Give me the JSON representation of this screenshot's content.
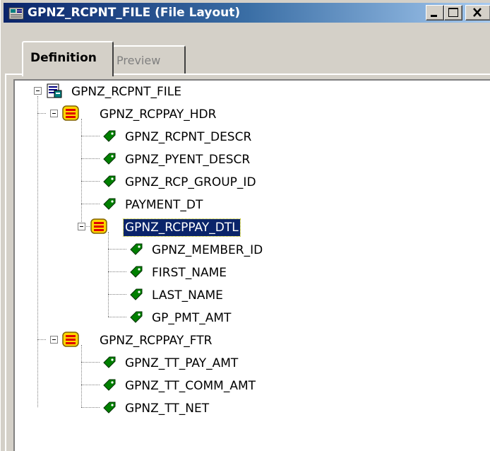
{
  "window": {
    "title": "GPNZ_RCPNT_FILE (File Layout)",
    "icon": "file-layout-icon"
  },
  "tabs": [
    {
      "label": "Definition",
      "active": true
    },
    {
      "label": "Preview",
      "active": false
    }
  ],
  "tree": {
    "root": {
      "label": "GPNZ_RCPNT_FILE",
      "icon": "file-layout-icon",
      "expanded": true
    },
    "records": [
      {
        "label": "GPNZ_RCPPAY_HDR",
        "icon": "record-icon",
        "expanded": true,
        "fields": [
          {
            "label": "GPNZ_RCPNT_DESCR",
            "icon": "field-icon"
          },
          {
            "label": "GPNZ_PYENT_DESCR",
            "icon": "field-icon"
          },
          {
            "label": "GPNZ_RCP_GROUP_ID",
            "icon": "field-icon"
          },
          {
            "label": "PAYMENT_DT",
            "icon": "field-icon"
          }
        ],
        "child_record": {
          "label": "GPNZ_RCPPAY_DTL",
          "icon": "record-icon",
          "expanded": true,
          "selected": true,
          "fields": [
            {
              "label": "GPNZ_MEMBER_ID",
              "icon": "field-icon"
            },
            {
              "label": "FIRST_NAME",
              "icon": "field-icon"
            },
            {
              "label": "LAST_NAME",
              "icon": "field-icon"
            },
            {
              "label": "GP_PMT_AMT",
              "icon": "field-icon"
            }
          ]
        }
      },
      {
        "label": "GPNZ_RCPPAY_FTR",
        "icon": "record-icon",
        "expanded": true,
        "fields": [
          {
            "label": "GPNZ_TT_PAY_AMT",
            "icon": "field-icon"
          },
          {
            "label": "GPNZ_TT_COMM_AMT",
            "icon": "field-icon"
          },
          {
            "label": "GPNZ_TT_NET",
            "icon": "field-icon"
          }
        ]
      }
    ]
  },
  "colors": {
    "title_bar_start": "#0a246a",
    "title_bar_end": "#a6caf0",
    "selection": "#0a246a",
    "face": "#d4d0c8"
  }
}
